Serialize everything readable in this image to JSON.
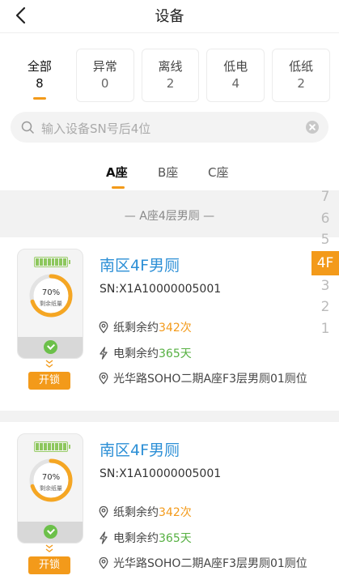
{
  "header": {
    "title": "设备",
    "back_icon": "back-arrow-icon"
  },
  "stats": [
    {
      "label": "全部",
      "count": "8",
      "active": true
    },
    {
      "label": "异常",
      "count": "0"
    },
    {
      "label": "离线",
      "count": "2"
    },
    {
      "label": "低电",
      "count": "4"
    },
    {
      "label": "低纸",
      "count": "2"
    }
  ],
  "search": {
    "placeholder": "输入设备SN号后4位",
    "icon": "search-icon",
    "clear_icon": "clear-icon"
  },
  "tabs": [
    {
      "label": "A座",
      "active": true
    },
    {
      "label": "B座"
    },
    {
      "label": "C座"
    }
  ],
  "group_title": "— A座4层男厕 —",
  "floors": [
    "7",
    "6",
    "5",
    "4F",
    "3",
    "2",
    "1"
  ],
  "active_floor": "4F",
  "colors": {
    "accent": "#f39a1a",
    "link": "#2c8fd6",
    "green": "#56b042"
  },
  "devices": [
    {
      "name": "南区4F男厕",
      "sn": "SN:X1A10000005001",
      "percent_label": "70%",
      "percent_value": 70,
      "percent_caption": "剩余纸量",
      "paper_prefix": "纸剩余约",
      "paper_value": "342次",
      "power_prefix": "电剩余约",
      "power_value": "365天",
      "location": "光华路SOHO二期A座F3层男厕01厕位",
      "unlock_label": "开锁"
    },
    {
      "name": "南区4F男厕",
      "sn": "SN:X1A10000005001",
      "percent_label": "70%",
      "percent_value": 70,
      "percent_caption": "剩余纸量",
      "paper_prefix": "纸剩余约",
      "paper_value": "342次",
      "power_prefix": "电剩余约",
      "power_value": "365天",
      "location": "光华路SOHO二期A座F3层男厕01厕位",
      "unlock_label": "开锁"
    }
  ]
}
